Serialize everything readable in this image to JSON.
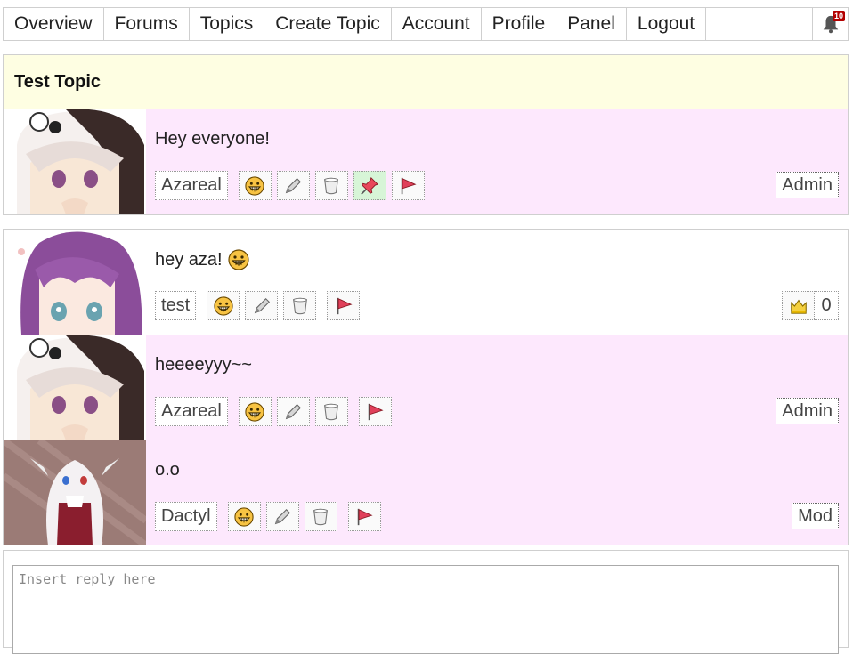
{
  "nav": {
    "items": [
      "Overview",
      "Forums",
      "Topics",
      "Create Topic",
      "Account",
      "Profile",
      "Panel",
      "Logout"
    ],
    "notification_count": "10",
    "bell_icon": "bell-icon"
  },
  "topic": {
    "title": "Test Topic"
  },
  "posts": [
    {
      "author": "Azareal",
      "content": "Hey everyone!",
      "rank": "Admin",
      "pinned": true
    },
    {
      "author": "test",
      "content": "hey aza!",
      "emoji": "grin-emoji",
      "level_count": "0"
    },
    {
      "author": "Azareal",
      "content": "heeeeyyy~~",
      "rank": "Admin"
    },
    {
      "author": "Dactyl",
      "content": "o.o",
      "rank": "Mod"
    }
  ],
  "icons": {
    "like": "grin-icon",
    "edit": "pencil-icon",
    "delete": "trash-icon",
    "pin": "pin-icon",
    "report": "flag-icon",
    "level": "crown-icon"
  },
  "reply": {
    "placeholder": "Insert reply here"
  },
  "colors": {
    "topic_header": "#fefee2",
    "post_pink": "#fde8fd",
    "pinned": "#d7f5d7",
    "flag": "#e0405a"
  }
}
